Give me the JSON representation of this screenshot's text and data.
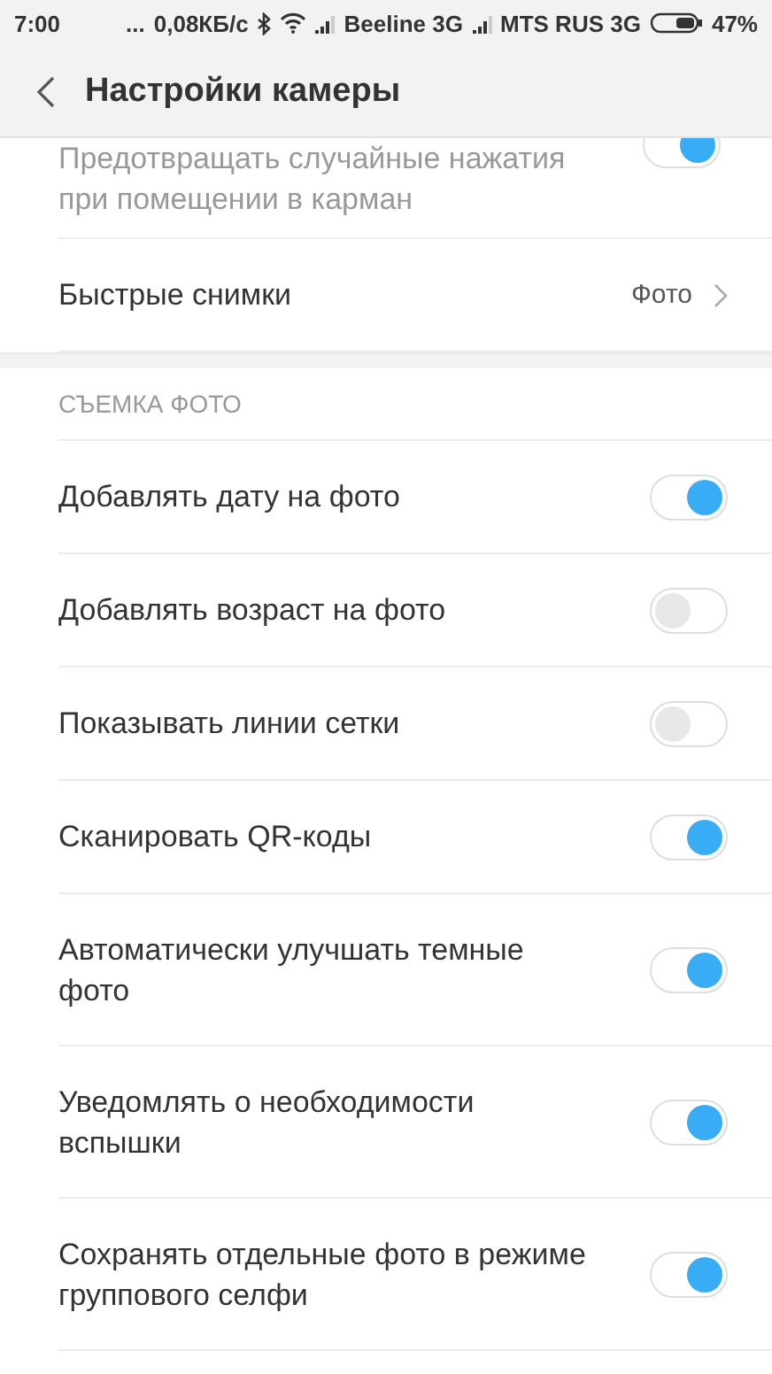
{
  "status_bar": {
    "time": "7:00",
    "dots": "...",
    "speed": "0,08КБ/с",
    "carrier_1": "Beeline 3G",
    "carrier_2": "MTS RUS 3G",
    "battery": "47%"
  },
  "header": {
    "title": "Настройки камеры"
  },
  "top_items": [
    {
      "kind": "toggle",
      "label": "Предотвращать случайные нажатия при помещении в карман",
      "on": true,
      "disabled": true
    },
    {
      "kind": "link",
      "label": "Быстрые снимки",
      "value": "Фото"
    }
  ],
  "section": {
    "title": "СЪЕМКА ФОТО",
    "items": [
      {
        "kind": "toggle",
        "label": "Добавлять дату на фото",
        "on": true
      },
      {
        "kind": "toggle",
        "label": "Добавлять возраст на фото",
        "on": false
      },
      {
        "kind": "toggle",
        "label": "Показывать линии сетки",
        "on": false
      },
      {
        "kind": "toggle",
        "label": "Сканировать QR-коды",
        "on": true
      },
      {
        "kind": "toggle",
        "label": "Автоматически улучшать темные фото",
        "on": true
      },
      {
        "kind": "toggle",
        "label": "Уведомлять о необходимости вспышки",
        "on": true
      },
      {
        "kind": "toggle",
        "label": "Сохранять отдельные фото в режиме группового селфи",
        "on": true
      }
    ]
  }
}
